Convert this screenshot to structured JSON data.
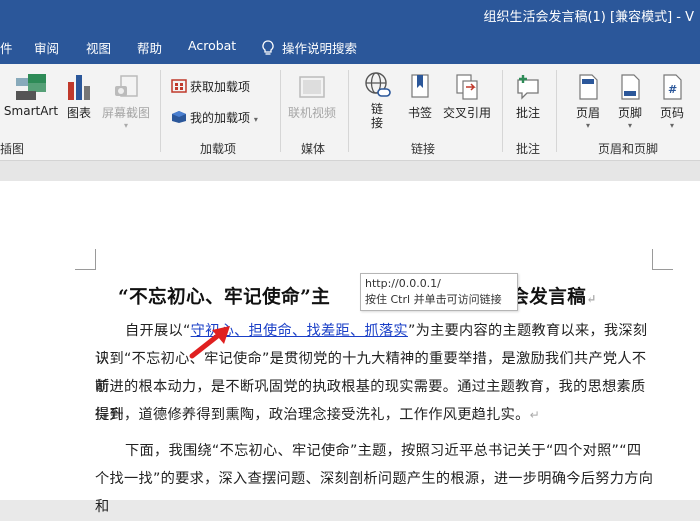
{
  "window": {
    "title": "组织生活会发言稿(1) [兼容模式] - V"
  },
  "menu": {
    "items": [
      "件",
      "审阅",
      "视图",
      "帮助",
      "Acrobat"
    ],
    "tell_me": "操作说明搜索"
  },
  "ribbon": {
    "smartart": "SmartArt",
    "chart": "图表",
    "screenshot": "屏幕截图",
    "get_addins": "获取加载项",
    "my_addins": "我的加载项",
    "online_video": "联机视频",
    "link": "链接",
    "bookmark": "书签",
    "cross_ref": "交叉引用",
    "comment": "批注",
    "header": "页眉",
    "footer": "页脚",
    "page_number": "页码",
    "groups": {
      "illustrations": "插图",
      "addins": "加载项",
      "media": "媒体",
      "links": "链接",
      "comments": "批注",
      "header_footer": "页眉和页脚"
    }
  },
  "document": {
    "title_left": "“不忘初心、牢记使命”主",
    "title_right": "生活会发言稿",
    "p1_pre": "自开展以“",
    "p1_link": "守初心、担使命、找差距、抓落实",
    "p1_post": "”为主要内容的主题教育以来，我深刻认",
    "p2": "识到“不忘初心、牢记使命”是贯彻党的十九大精神的重要举措，是激励我们共产党人不断",
    "p3": "前进的根本动力，是不断巩固党的执政根基的现实需要。通过主题教育，我的思想素质得到",
    "p4": "提升，道德修养得到熏陶，政治理念接受洗礼，工作作风更趋扎实。",
    "p5": "下面，我围绕“不忘初心、牢记使命”主题，按照习近平总书记关于“四个对照”“四",
    "p6": "个找一找”的要求，深入查摆问题、深刻剖析问题产生的根源，进一步明确今后努力方向和"
  },
  "tooltip": {
    "url": "http://0.0.0.1/",
    "hint": "按住 Ctrl 并单击可访问链接"
  },
  "colors": {
    "titlebar": "#2b579a",
    "link": "#1a3fc7",
    "arrow": "#e02020"
  }
}
